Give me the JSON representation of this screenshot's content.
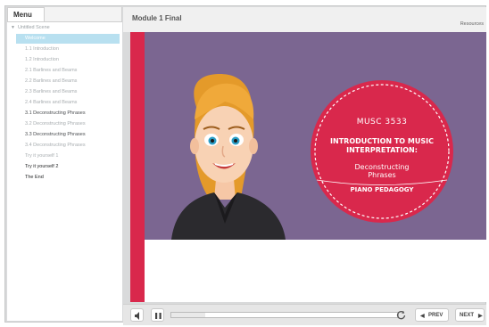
{
  "sidebar": {
    "menu_tab": "Menu",
    "scene_title": "Untitled Scene",
    "items": [
      {
        "label": "Welcome"
      },
      {
        "label": "1.1 Introduction"
      },
      {
        "label": "1.2 Introduction"
      },
      {
        "label": "2.1 Barlines and Beams"
      },
      {
        "label": "2.2 Barlines and Beams"
      },
      {
        "label": "2.3 Barlines and Beams"
      },
      {
        "label": "2.4 Barlines and Beams"
      },
      {
        "label": "3.1 Deconstructing Phrases"
      },
      {
        "label": "3.2 Deconstructing Phrases"
      },
      {
        "label": "3.3 Deconstructing Phrases"
      },
      {
        "label": "3.4 Deconstructing Phrases"
      },
      {
        "label": "Try it yourself 1"
      },
      {
        "label": "Try it yourself 2"
      },
      {
        "label": "The End"
      }
    ]
  },
  "header": {
    "title": "Module 1 Final",
    "resources": "Resources"
  },
  "slide": {
    "course_code": "MUSC 3533",
    "title": "INTRODUCTION TO MUSIC INTERPRETATION:",
    "subtitle": "Deconstructing Phrases",
    "footer": "PIANO PEDAGOGY"
  },
  "player": {
    "prev_label": "PREV",
    "next_label": "NEXT",
    "progress": 0.15
  },
  "colors": {
    "accent_red": "#d9284c",
    "slide_purple": "#7b6691",
    "selected_item": "#b8e0f0"
  }
}
